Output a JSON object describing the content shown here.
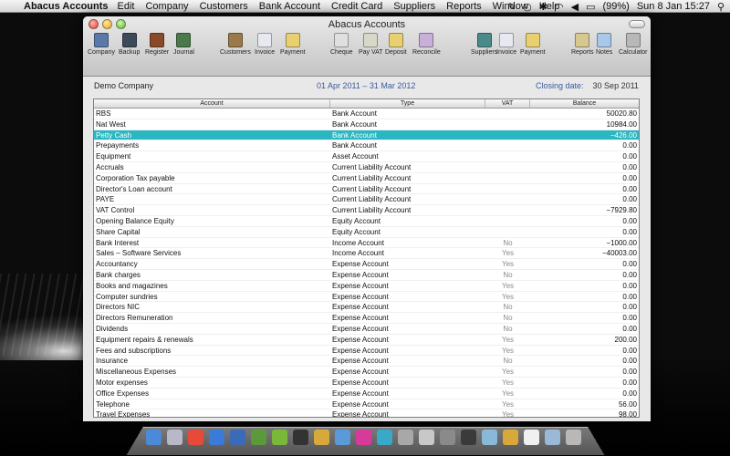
{
  "menubar": {
    "app": "Abacus Accounts",
    "menus": [
      "Edit",
      "Company",
      "Customers",
      "Bank Account",
      "Credit Card",
      "Suppliers",
      "Reports",
      "Window",
      "Help"
    ],
    "battery": "(99%)",
    "clock": "Sun 8 Jan  15:27"
  },
  "window": {
    "title": "Abacus Accounts"
  },
  "toolbar": [
    {
      "label": "Company",
      "icon": "company-icon",
      "color": "#5a78a8"
    },
    {
      "label": "Backup",
      "icon": "backup-icon",
      "color": "#3c4a5a"
    },
    {
      "label": "Register",
      "icon": "register-icon",
      "color": "#8a4a2a"
    },
    {
      "label": "Journal",
      "icon": "journal-icon",
      "color": "#4a7a4a"
    },
    {
      "label": "Customers",
      "icon": "customers-icon",
      "color": "#9a7a4a"
    },
    {
      "label": "Invoice",
      "icon": "invoice-icon",
      "color": "#e8e8f0"
    },
    {
      "label": "Payment",
      "icon": "payment-icon",
      "color": "#e8d070"
    },
    {
      "label": "Cheque",
      "icon": "cheque-icon",
      "color": "#e0e0e0"
    },
    {
      "label": "Pay VAT",
      "icon": "pay-vat-icon",
      "color": "#d8d8c8"
    },
    {
      "label": "Deposit",
      "icon": "deposit-icon",
      "color": "#e8d070"
    },
    {
      "label": "Reconcile",
      "icon": "reconcile-icon",
      "color": "#c8b0d8"
    },
    {
      "label": "Suppliers",
      "icon": "suppliers-icon",
      "color": "#4a8a8a"
    },
    {
      "label": "Invoice",
      "icon": "supplier-invoice-icon",
      "color": "#e8e8f0"
    },
    {
      "label": "Payment",
      "icon": "supplier-payment-icon",
      "color": "#e8d070"
    },
    {
      "label": "Reports",
      "icon": "reports-icon",
      "color": "#d8c890"
    },
    {
      "label": "Notes",
      "icon": "notes-icon",
      "color": "#a8c8e8"
    },
    {
      "label": "Calculator",
      "icon": "calculator-icon",
      "color": "#b8b8b8"
    }
  ],
  "header": {
    "company": "Demo Company",
    "period": "01 Apr 2011 – 31 Mar 2012",
    "closing_label": "Closing date:",
    "closing_date": "30 Sep 2011"
  },
  "table": {
    "columns": [
      "Account",
      "Type",
      "VAT",
      "Balance"
    ],
    "selected_color": "#2ab7c2",
    "rows": [
      {
        "account": "RBS",
        "type": "Bank Account",
        "vat": "",
        "balance": "50020.80"
      },
      {
        "account": "Nat West",
        "type": "Bank Account",
        "vat": "",
        "balance": "10984.00"
      },
      {
        "account": "Petty Cash",
        "type": "Bank Account",
        "vat": "",
        "balance": "−426.00",
        "selected": true
      },
      {
        "account": "Prepayments",
        "type": "Bank Account",
        "vat": "",
        "balance": "0.00"
      },
      {
        "account": "Equipment",
        "type": "Asset Account",
        "vat": "",
        "balance": "0.00"
      },
      {
        "account": "Accruals",
        "type": "Current Liability Account",
        "vat": "",
        "balance": "0.00"
      },
      {
        "account": "Corporation Tax payable",
        "type": "Current Liability Account",
        "vat": "",
        "balance": "0.00"
      },
      {
        "account": "Director's Loan account",
        "type": "Current Liability Account",
        "vat": "",
        "balance": "0.00"
      },
      {
        "account": "PAYE",
        "type": "Current Liability Account",
        "vat": "",
        "balance": "0.00"
      },
      {
        "account": "VAT Control",
        "type": "Current Liability Account",
        "vat": "",
        "balance": "−7929.80"
      },
      {
        "account": "Opening Balance Equity",
        "type": "Equity Account",
        "vat": "",
        "balance": "0.00"
      },
      {
        "account": "Share Capital",
        "type": "Equity Account",
        "vat": "",
        "balance": "0.00"
      },
      {
        "account": "Bank Interest",
        "type": "Income Account",
        "vat": "No",
        "balance": "−1000.00"
      },
      {
        "account": "Sales – Software Services",
        "type": "Income Account",
        "vat": "Yes",
        "balance": "−40003.00"
      },
      {
        "account": "Accountancy",
        "type": "Expense Account",
        "vat": "Yes",
        "balance": "0.00"
      },
      {
        "account": "Bank charges",
        "type": "Expense Account",
        "vat": "No",
        "balance": "0.00"
      },
      {
        "account": "Books and magazines",
        "type": "Expense Account",
        "vat": "Yes",
        "balance": "0.00"
      },
      {
        "account": "Computer sundries",
        "type": "Expense Account",
        "vat": "Yes",
        "balance": "0.00"
      },
      {
        "account": "Directors NIC",
        "type": "Expense Account",
        "vat": "No",
        "balance": "0.00"
      },
      {
        "account": "Directors Remuneration",
        "type": "Expense Account",
        "vat": "No",
        "balance": "0.00"
      },
      {
        "account": "Dividends",
        "type": "Expense Account",
        "vat": "No",
        "balance": "0.00"
      },
      {
        "account": "Equipment repairs & renewals",
        "type": "Expense Account",
        "vat": "Yes",
        "balance": "200.00"
      },
      {
        "account": "Fees and subscriptions",
        "type": "Expense Account",
        "vat": "Yes",
        "balance": "0.00"
      },
      {
        "account": "Insurance",
        "type": "Expense Account",
        "vat": "No",
        "balance": "0.00"
      },
      {
        "account": "Miscellaneous Expenses",
        "type": "Expense Account",
        "vat": "Yes",
        "balance": "0.00"
      },
      {
        "account": "Motor expenses",
        "type": "Expense Account",
        "vat": "Yes",
        "balance": "0.00"
      },
      {
        "account": "Office Expenses",
        "type": "Expense Account",
        "vat": "Yes",
        "balance": "0.00"
      },
      {
        "account": "Telephone",
        "type": "Expense Account",
        "vat": "Yes",
        "balance": "56.00"
      },
      {
        "account": "Travel Expenses",
        "type": "Expense Account",
        "vat": "Yes",
        "balance": "98.00"
      }
    ]
  },
  "dock": [
    {
      "icon": "finder-icon",
      "color": "#4a8ad8"
    },
    {
      "icon": "mail-icon",
      "color": "#b8b8c8"
    },
    {
      "icon": "calendar-icon",
      "color": "#e84a3a"
    },
    {
      "icon": "safari-icon",
      "color": "#3a7ad8"
    },
    {
      "icon": "earth-icon",
      "color": "#3a6ab8"
    },
    {
      "icon": "facetime-icon",
      "color": "#5a9a3a"
    },
    {
      "icon": "spotify-icon",
      "color": "#7ab83a"
    },
    {
      "icon": "terminal-icon",
      "color": "#333"
    },
    {
      "icon": "photos-icon",
      "color": "#d8a83a"
    },
    {
      "icon": "itunes-icon",
      "color": "#5a9ad8"
    },
    {
      "icon": "media-icon",
      "color": "#d83a9a"
    },
    {
      "icon": "stream-icon",
      "color": "#3aa8c8"
    },
    {
      "icon": "calculator-icon",
      "color": "#a8a8a8"
    },
    {
      "icon": "preview-icon",
      "color": "#c8c8c8"
    },
    {
      "icon": "preferences-icon",
      "color": "#8a8a8a"
    },
    {
      "icon": "activity-icon",
      "color": "#3a3a3a"
    },
    {
      "icon": "mirror-icon",
      "color": "#8ab8d8"
    },
    {
      "icon": "gold-icon",
      "color": "#d8a83a"
    },
    {
      "icon": "document-icon",
      "color": "#f0f0f0"
    },
    {
      "icon": "folder-icon",
      "color": "#9ab8d8"
    },
    {
      "icon": "trash-icon",
      "color": "#b8b8b8"
    }
  ]
}
